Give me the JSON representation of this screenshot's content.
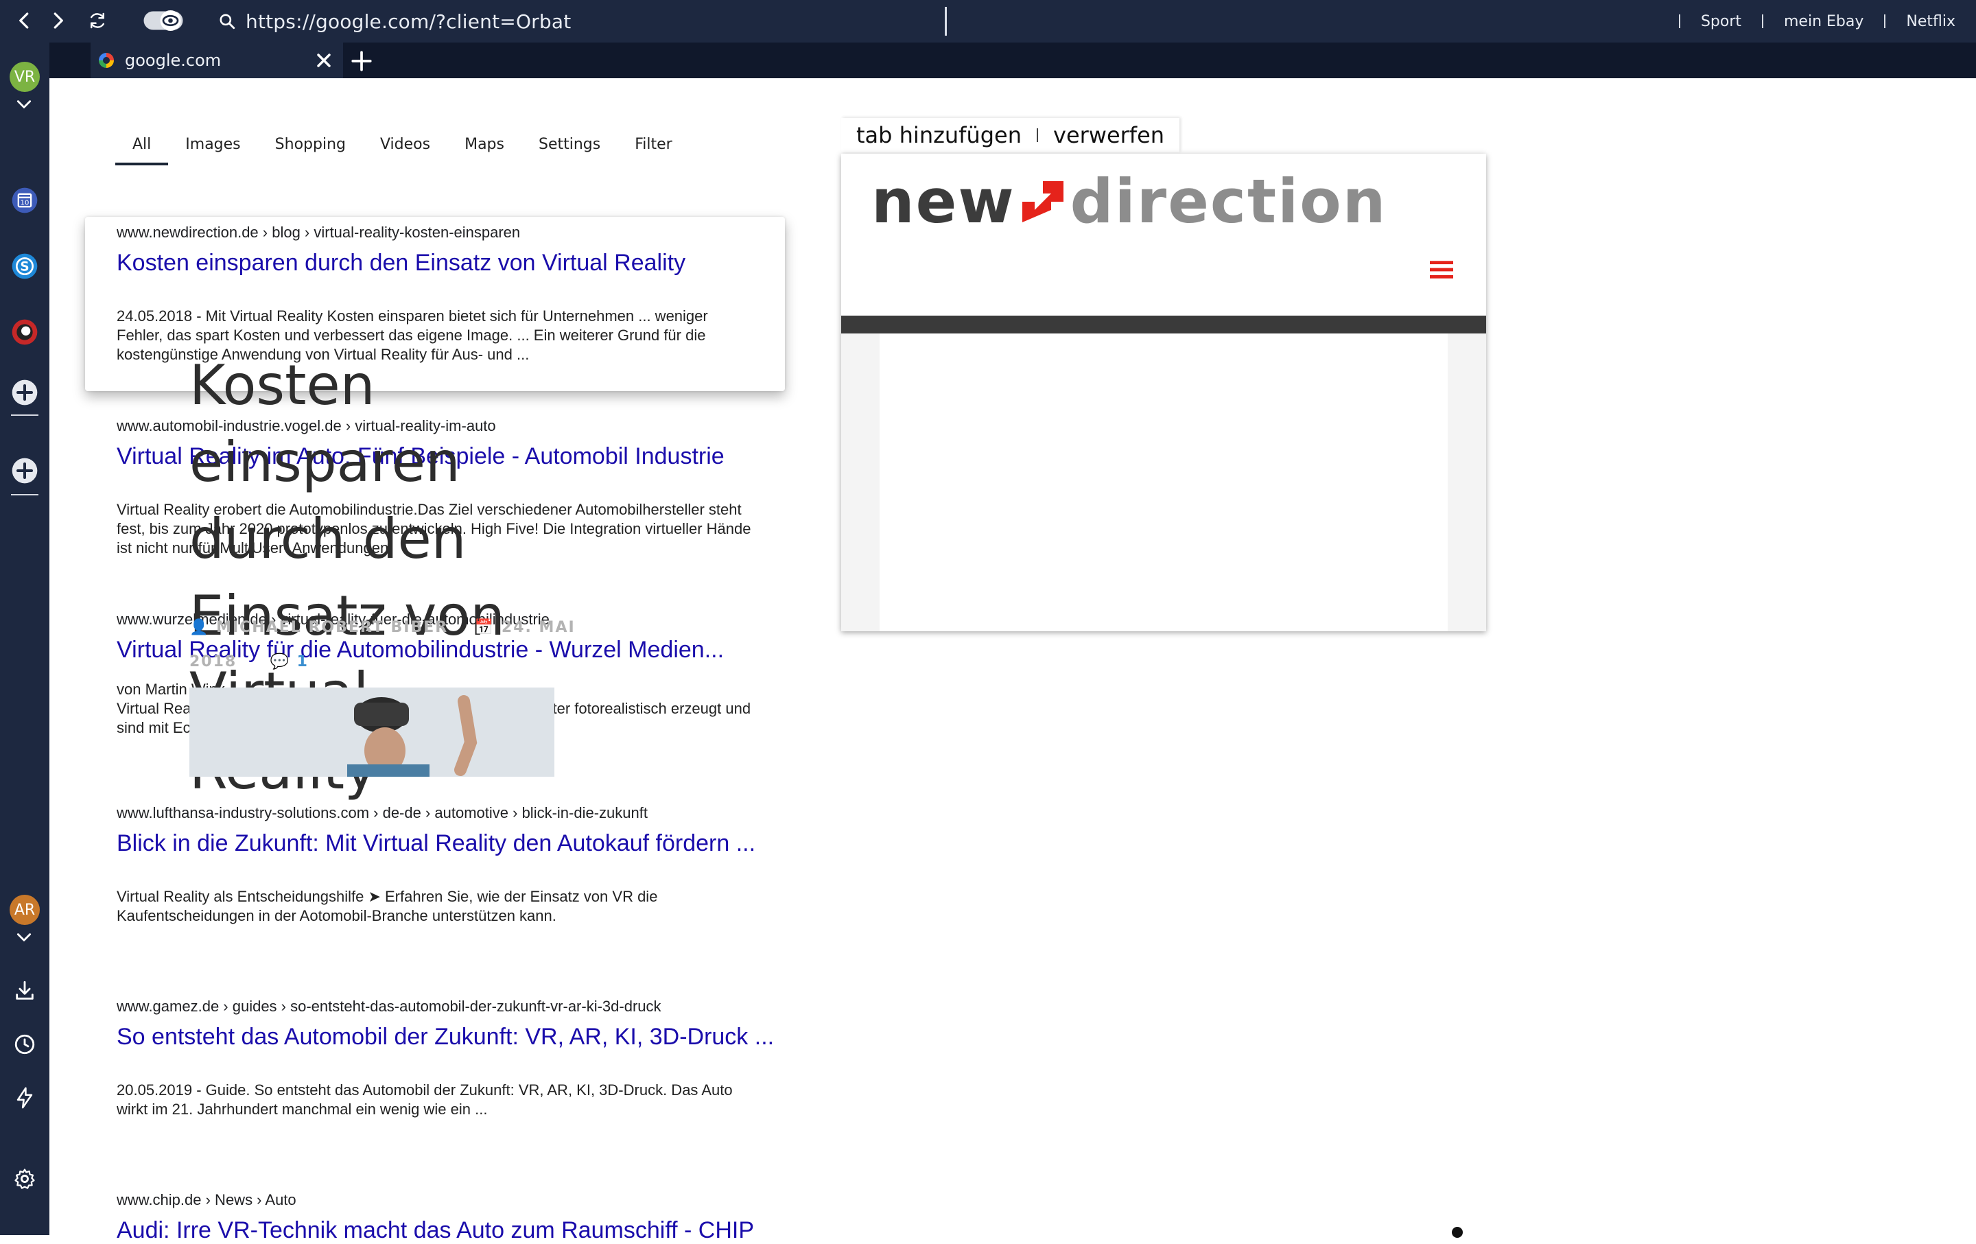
{
  "browser": {
    "url": "https://google.com/?client=Orbat",
    "bookmarks": [
      "Sport",
      "mein Ebay",
      "Netflix"
    ],
    "tab": {
      "title": "google.com"
    }
  },
  "sidebar": {
    "top_avatar": {
      "initials": "VR",
      "color": "#7cb342"
    },
    "bottom_avatar": {
      "initials": "AR",
      "color": "#c8782a"
    }
  },
  "search": {
    "tabs": [
      "All",
      "Images",
      "Shopping",
      "Videos",
      "Maps",
      "Settings",
      "Filter"
    ],
    "active_tab": "All",
    "results": [
      {
        "cite": "www.newdirection.de › blog › virtual-reality-kosten-einsparen",
        "title": "Kosten einsparen durch den Einsatz von Virtual Reality",
        "snippet": "24.05.2018 - Mit Virtual Reality Kosten einsparen bietet sich für Unternehmen ... weniger Fehler, das spart Kosten und verbessert das eigene Image. ... Ein weiterer Grund für die kostengünstige Anwendung von Virtual Reality für Aus- und ..."
      },
      {
        "cite": "www.automobil-industrie.vogel.de › virtual-reality-im-auto",
        "title": "Virtual Reality im Auto: Fünf Beispiele - Automobil Industrie",
        "snippet": "Virtual Reality erobert die Automobilindustrie.Das Ziel verschiedener Automobilhersteller steht fest, bis zum Jahr 2020 prototypenlos zu entwickeln. High Five! Die Integration virtueller Hände ist nicht nur für MultiUser- Anwendungen."
      },
      {
        "cite": "www.wurzelmedien.de › virtual-reality-fuer-die-automobilindustrie",
        "title": "Virtual Reality für die Automobilindustrie - Wurzel Medien...",
        "snippet": "von Martin Wink\nVirtual Reality erobert die Automobilindustrie. Modelle am Computer fotorealistisch erzeugt und sind mit Echtzeit-Virtual-Reality aus jedem..."
      },
      {
        "cite": "www.lufthansa-industry-solutions.com › de-de › automotive › blick-in-die-zukunft",
        "title": "Blick in die Zukunft: Mit Virtual Reality den Autokauf fördern ...",
        "snippet": "Virtual Reality als Entscheidungshilfe ➤ Erfahren Sie, wie der Einsatz von VR die Kaufentscheidungen in der Aotomobil-Branche unterstützen kann."
      },
      {
        "cite": "www.gamez.de › guides › so-entsteht-das-automobil-der-zukunft-vr-ar-ki-3d-druck",
        "title": "So entsteht das Automobil der Zukunft: VR, AR, KI, 3D-Druck ...",
        "snippet": "20.05.2019 - Guide. So entsteht das Automobil der Zukunft: VR, AR, KI, 3D-Druck. Das Auto wirkt im 21. Jahrhundert manchmal ein wenig wie ein ..."
      },
      {
        "cite": "www.chip.de › News › Auto",
        "title": "Audi: Irre VR-Technik macht das Auto zum Raumschiff - CHIP"
      }
    ]
  },
  "preview": {
    "add_tab_label": "tab hinzufügen",
    "discard_label": "verwerfen",
    "logo": {
      "part1": "new",
      "part2": "direction",
      "accent_color": "#e5231b"
    },
    "article_title_lines": [
      "Kosten",
      "einsparen",
      "durch den",
      "Einsatz von",
      "Virtual Reality"
    ],
    "author": "MICHAEL ROBERT BIBER",
    "date_part1": "24. MAI",
    "date_part2": "2018",
    "comments": "1"
  }
}
